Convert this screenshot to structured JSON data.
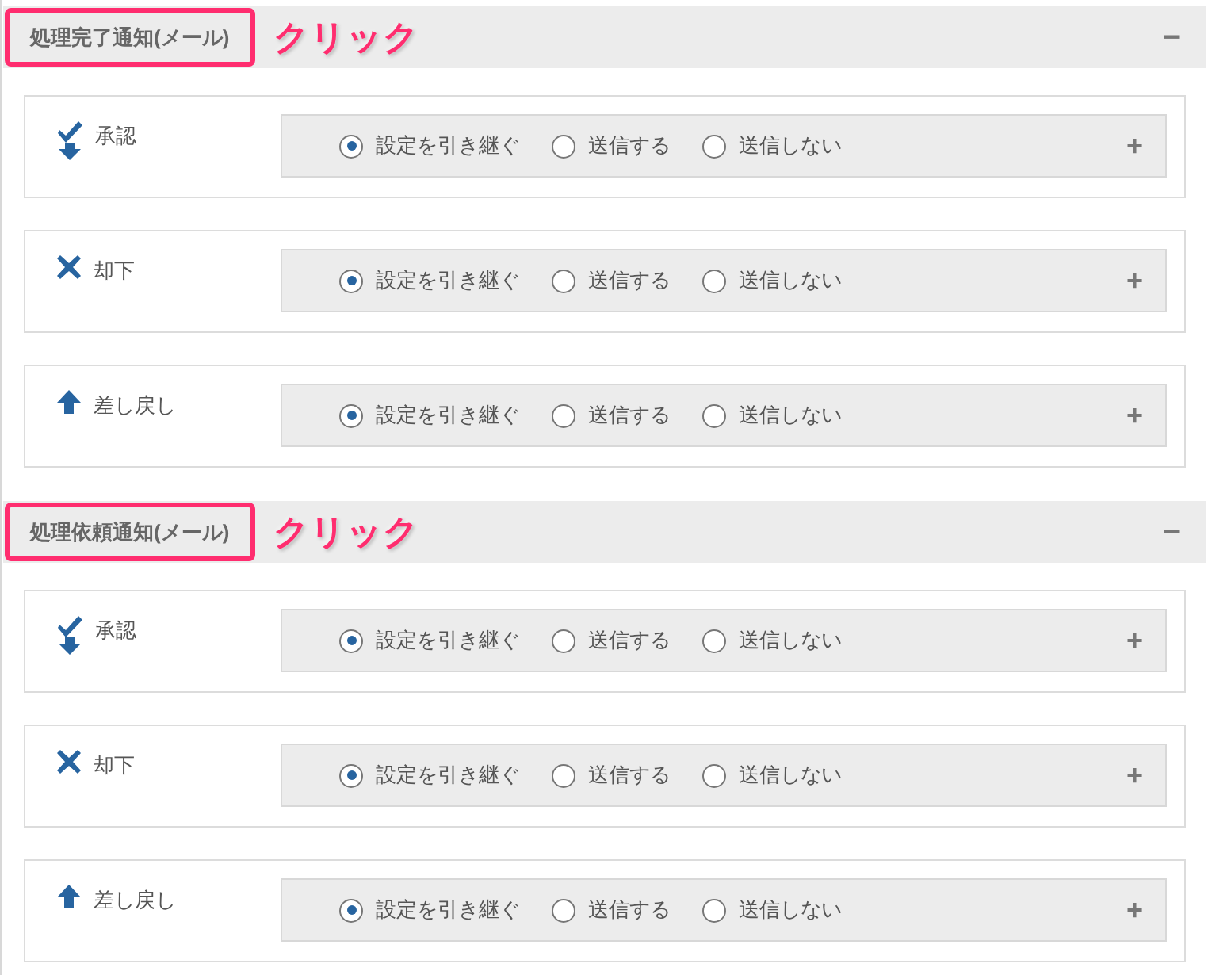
{
  "sections": [
    {
      "title": "処理完了通知(メール)",
      "annotation": "クリック",
      "toggle": "−",
      "rows": [
        {
          "kind": "approve",
          "label": "承認",
          "toggle": "+",
          "options": [
            {
              "label": "設定を引き継ぐ",
              "selected": true
            },
            {
              "label": "送信する",
              "selected": false
            },
            {
              "label": "送信しない",
              "selected": false
            }
          ]
        },
        {
          "kind": "reject",
          "label": "却下",
          "toggle": "+",
          "options": [
            {
              "label": "設定を引き継ぐ",
              "selected": true
            },
            {
              "label": "送信する",
              "selected": false
            },
            {
              "label": "送信しない",
              "selected": false
            }
          ]
        },
        {
          "kind": "sendback",
          "label": "差し戻し",
          "toggle": "+",
          "options": [
            {
              "label": "設定を引き継ぐ",
              "selected": true
            },
            {
              "label": "送信する",
              "selected": false
            },
            {
              "label": "送信しない",
              "selected": false
            }
          ]
        }
      ]
    },
    {
      "title": "処理依頼通知(メール)",
      "annotation": "クリック",
      "toggle": "−",
      "rows": [
        {
          "kind": "approve",
          "label": "承認",
          "toggle": "+",
          "options": [
            {
              "label": "設定を引き継ぐ",
              "selected": true
            },
            {
              "label": "送信する",
              "selected": false
            },
            {
              "label": "送信しない",
              "selected": false
            }
          ]
        },
        {
          "kind": "reject",
          "label": "却下",
          "toggle": "+",
          "options": [
            {
              "label": "設定を引き継ぐ",
              "selected": true
            },
            {
              "label": "送信する",
              "selected": false
            },
            {
              "label": "送信しない",
              "selected": false
            }
          ]
        },
        {
          "kind": "sendback",
          "label": "差し戻し",
          "toggle": "+",
          "options": [
            {
              "label": "設定を引き継ぐ",
              "selected": true
            },
            {
              "label": "送信する",
              "selected": false
            },
            {
              "label": "送信しない",
              "selected": false
            }
          ]
        }
      ]
    }
  ]
}
